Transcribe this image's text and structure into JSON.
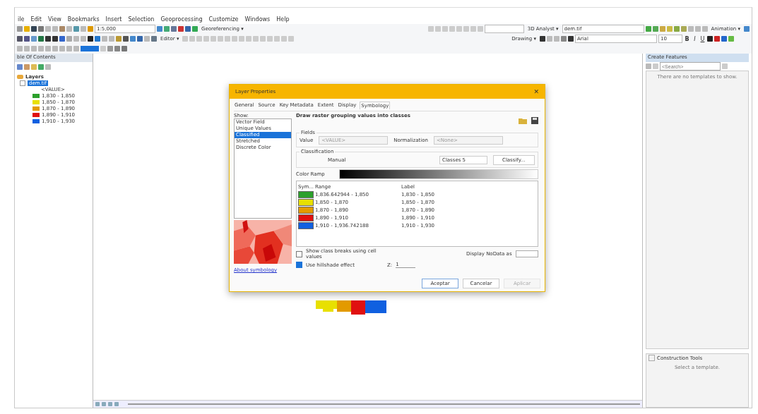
{
  "menu": [
    "ile",
    "Edit",
    "View",
    "Bookmarks",
    "Insert",
    "Selection",
    "Geoprocessing",
    "Customize",
    "Windows",
    "Help"
  ],
  "toolbar": {
    "scale": "1:5,000",
    "georeferencing": "Georeferencing ▾",
    "analyst": "3D Analyst ▾",
    "analyst_layer": "dem.tif",
    "animation": "Animation ▾",
    "editor": "Editor ▾",
    "drawing": "Drawing ▾",
    "font": "Arial",
    "font_size": "10",
    "bold": "B",
    "italic": "I",
    "underline": "U"
  },
  "toc": {
    "title": "ble Of Contents",
    "root": "Layers",
    "layer": {
      "name": "dem.tif",
      "selected": true,
      "checked": false,
      "field": "<VALUE>"
    },
    "classes": [
      {
        "label": "1,830 - 1,850",
        "color": "#2ca02c"
      },
      {
        "label": "1,850 - 1,870",
        "color": "#e8e000"
      },
      {
        "label": "1,870 - 1,890",
        "color": "#e39a00"
      },
      {
        "label": "1,890 - 1,910",
        "color": "#e01010"
      },
      {
        "label": "1,910 - 1,930",
        "color": "#1060e0"
      }
    ]
  },
  "dialog": {
    "title": "Layer Properties",
    "close": "✕",
    "tabs": [
      {
        "label": "General",
        "selected": false
      },
      {
        "label": "Source",
        "selected": false
      },
      {
        "label": "Key Metadata",
        "selected": false
      },
      {
        "label": "Extent",
        "selected": false
      },
      {
        "label": "Display",
        "selected": false
      },
      {
        "label": "Symbology",
        "selected": true
      }
    ],
    "show_label": "Show:",
    "show_items": [
      {
        "label": "Vector Field",
        "selected": false
      },
      {
        "label": "Unique Values",
        "selected": false
      },
      {
        "label": "Classified",
        "selected": true
      },
      {
        "label": "Stretched",
        "selected": false
      },
      {
        "label": "Discrete Color",
        "selected": false
      }
    ],
    "about_link": "About symbology",
    "heading": "Draw raster grouping values into classes",
    "fields_label": "Fields",
    "value_label": "Value",
    "value": "<VALUE>",
    "normalization_label": "Normalization",
    "normalization": "<None>",
    "classification_label": "Classification",
    "method": "Manual",
    "classes": "Classes 5",
    "classify_button": "Classify...",
    "color_ramp_label": "Color Ramp",
    "columns": [
      "Sym...",
      "Range",
      "Label"
    ],
    "rows": [
      {
        "color": "#2ca02c",
        "range": "1,836.642944 - 1,850",
        "label": "1,830 - 1,850"
      },
      {
        "color": "#e8e000",
        "range": "1,850 - 1,870",
        "label": "1,850 - 1,870"
      },
      {
        "color": "#e39a00",
        "range": "1,870 - 1,890",
        "label": "1,870 - 1,890"
      },
      {
        "color": "#e01010",
        "range": "1,890 - 1,910",
        "label": "1,890 - 1,910"
      },
      {
        "color": "#1060e0",
        "range": "1,910 - 1,936.742188",
        "label": "1,910 - 1,930"
      }
    ],
    "show_breaks": {
      "label": "Show class breaks using cell values",
      "checked": false
    },
    "hillshade": {
      "label": "Use hillshade effect",
      "checked": true
    },
    "z_label": "Z:",
    "z_value": "1",
    "nodata_label": "Display NoData as",
    "buttons": [
      {
        "label": "Aceptar",
        "disabled": false
      },
      {
        "label": "Cancelar",
        "disabled": false
      },
      {
        "label": "Aplicar",
        "disabled": true
      }
    ]
  },
  "create_features": {
    "title": "Create Features",
    "search_placeholder": "<Search>",
    "empty": "There are no templates to show."
  },
  "construction_tools": {
    "title": "Construction Tools",
    "hint": "Select a template."
  }
}
